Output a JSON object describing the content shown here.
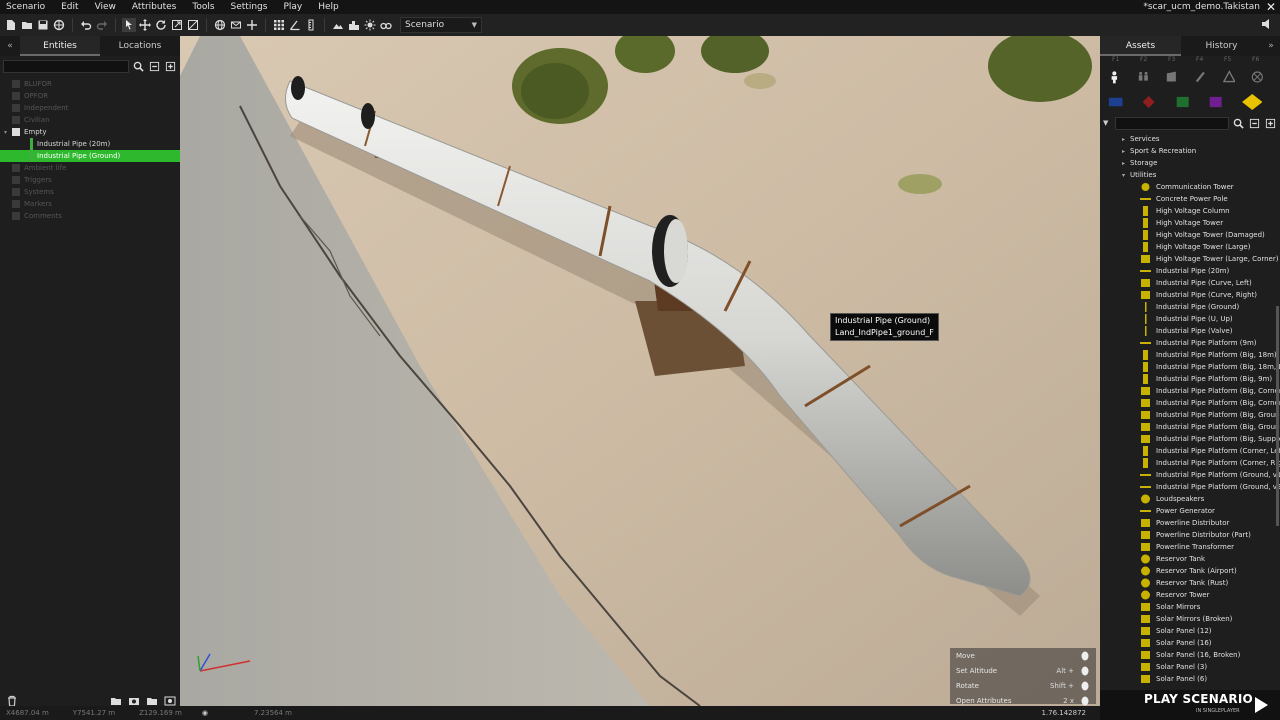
{
  "menubar": {
    "items": [
      "Scenario",
      "Edit",
      "View",
      "Attributes",
      "Tools",
      "Settings",
      "Play",
      "Help"
    ],
    "window_title": "*scar_ucm_demo.Takistan"
  },
  "toolbar": {
    "scenario_select": "Scenario"
  },
  "left_panel": {
    "tabs": [
      "Entities",
      "Locations"
    ],
    "tree": [
      {
        "label": "BLUFOR",
        "bright": false
      },
      {
        "label": "OPFOR",
        "bright": false
      },
      {
        "label": "Independent",
        "bright": false
      },
      {
        "label": "Civilian",
        "bright": false
      },
      {
        "label": "Empty",
        "bright": true,
        "expanded": true
      },
      {
        "label": "Industrial Pipe (20m)",
        "bright": true,
        "child": true
      },
      {
        "label": "Industrial Pipe (Ground)",
        "bright": true,
        "child": true,
        "selected": true
      },
      {
        "label": "Ambient life",
        "bright": false
      },
      {
        "label": "Triggers",
        "bright": false
      },
      {
        "label": "Systems",
        "bright": false
      },
      {
        "label": "Markers",
        "bright": false
      },
      {
        "label": "Comments",
        "bright": false
      }
    ]
  },
  "viewport": {
    "tooltip": {
      "line1": "Industrial Pipe (Ground)",
      "line2": "Land_IndPipe1_ground_F"
    },
    "hints": [
      {
        "label": "Move",
        "key": ""
      },
      {
        "label": "Set Altitude",
        "key": "Alt +"
      },
      {
        "label": "Rotate",
        "key": "Shift +"
      },
      {
        "label": "Open Attributes",
        "key": "2 x"
      }
    ]
  },
  "right_panel": {
    "tabs": [
      "Assets",
      "History"
    ],
    "fkeys": [
      "F1",
      "F2",
      "F3",
      "F4",
      "F5",
      "F6"
    ],
    "color_icons": [
      "#1f3f8f",
      "#8f1f1f",
      "#1f6f2f",
      "#6f1f8f",
      "#e8c400"
    ],
    "categories": [
      {
        "label": "Services",
        "expanded": false
      },
      {
        "label": "Sport & Recreation",
        "expanded": false
      },
      {
        "label": "Storage",
        "expanded": false
      },
      {
        "label": "Utilities",
        "expanded": true
      }
    ],
    "items": [
      {
        "label": "Communication Tower",
        "icon": "tower"
      },
      {
        "label": "Concrete Power Pole",
        "icon": "line"
      },
      {
        "label": "High Voltage Column",
        "icon": "pylon"
      },
      {
        "label": "High Voltage Tower",
        "icon": "pylon"
      },
      {
        "label": "High Voltage Tower (Damaged)",
        "icon": "pylon"
      },
      {
        "label": "High Voltage Tower (Large)",
        "icon": "pylon"
      },
      {
        "label": "High Voltage Tower (Large, Corner)",
        "icon": "box"
      },
      {
        "label": "Industrial Pipe (20m)",
        "icon": "line"
      },
      {
        "label": "Industrial Pipe (Curve, Left)",
        "icon": "box"
      },
      {
        "label": "Industrial Pipe (Curve, Right)",
        "icon": "box"
      },
      {
        "label": "Industrial Pipe (Ground)",
        "icon": "pipe"
      },
      {
        "label": "Industrial Pipe (U, Up)",
        "icon": "pipe"
      },
      {
        "label": "Industrial Pipe (Valve)",
        "icon": "pipe"
      },
      {
        "label": "Industrial Pipe Platform (9m)",
        "icon": "line"
      },
      {
        "label": "Industrial Pipe Platform (Big, 18m)",
        "icon": "pylon"
      },
      {
        "label": "Industrial Pipe Platform (Big, 18m, L",
        "icon": "pylon"
      },
      {
        "label": "Industrial Pipe Platform (Big, 9m)",
        "icon": "pylon"
      },
      {
        "label": "Industrial Pipe Platform (Big, Corner,",
        "icon": "box"
      },
      {
        "label": "Industrial Pipe Platform (Big, Corner,",
        "icon": "box"
      },
      {
        "label": "Industrial Pipe Platform (Big, Ground",
        "icon": "box"
      },
      {
        "label": "Industrial Pipe Platform (Big, Ground",
        "icon": "box"
      },
      {
        "label": "Industrial Pipe Platform (Big, Suppor",
        "icon": "box"
      },
      {
        "label": "Industrial Pipe Platform (Corner, Left",
        "icon": "pylon"
      },
      {
        "label": "Industrial Pipe Platform (Corner, Rig",
        "icon": "pylon"
      },
      {
        "label": "Industrial Pipe Platform (Ground, v1",
        "icon": "line"
      },
      {
        "label": "Industrial Pipe Platform (Ground, v2",
        "icon": "line"
      },
      {
        "label": "Loudspeakers",
        "icon": "circle"
      },
      {
        "label": "Power Generator",
        "icon": "line"
      },
      {
        "label": "Powerline Distributor",
        "icon": "box"
      },
      {
        "label": "Powerline Distributor (Part)",
        "icon": "box"
      },
      {
        "label": "Powerline Transformer",
        "icon": "box"
      },
      {
        "label": "Reservor Tank",
        "icon": "circle"
      },
      {
        "label": "Reservor Tank (Airport)",
        "icon": "circle"
      },
      {
        "label": "Reservor Tank (Rust)",
        "icon": "circle"
      },
      {
        "label": "Reservor Tower",
        "icon": "circle"
      },
      {
        "label": "Solar Mirrors",
        "icon": "box"
      },
      {
        "label": "Solar Mirrors (Broken)",
        "icon": "box"
      },
      {
        "label": "Solar Panel (12)",
        "icon": "box"
      },
      {
        "label": "Solar Panel (16)",
        "icon": "box"
      },
      {
        "label": "Solar Panel (16, Broken)",
        "icon": "box"
      },
      {
        "label": "Solar Panel (3)",
        "icon": "box"
      },
      {
        "label": "Solar Panel (6)",
        "icon": "box"
      }
    ]
  },
  "statusbar": {
    "x": "X4687.04 m",
    "y": "Y7541.27 m",
    "z": "Z129.169 m",
    "distance": "7.23564 m",
    "version": "1.76.142872"
  },
  "play": {
    "title": "PLAY SCENARIO",
    "subtitle": "IN SINGLEPLAYER"
  },
  "colors": {
    "selection": "#2eb82e",
    "accent_yellow": "#e8c400",
    "item_icon": "#c8b200"
  }
}
